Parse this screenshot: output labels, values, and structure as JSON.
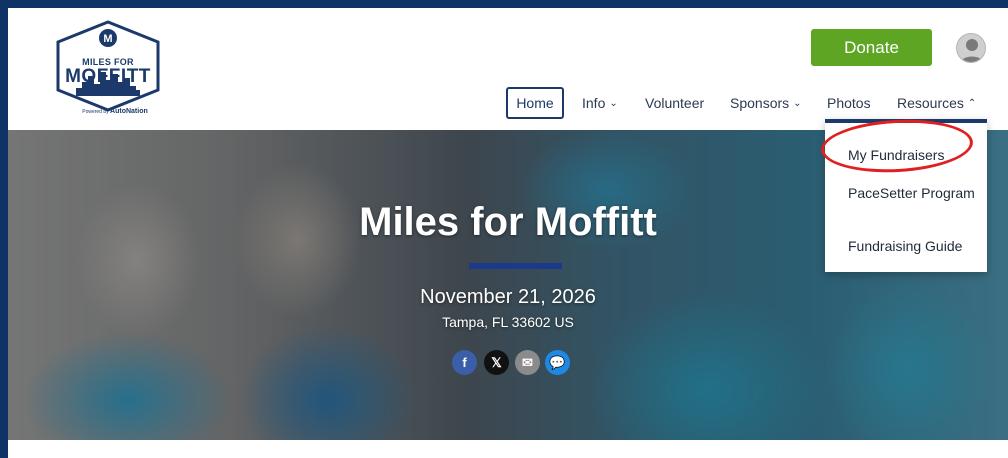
{
  "logo": {
    "top_text": "MILES FOR",
    "main_text": "MOFFITT",
    "powered_by": "Powered by",
    "sponsor": "AutoNation"
  },
  "header": {
    "donate_label": "Donate",
    "avatar_icon": "user-avatar-icon"
  },
  "nav": {
    "items": [
      {
        "label": "Home",
        "active": true
      },
      {
        "label": "Info",
        "has_dropdown": true
      },
      {
        "label": "Volunteer"
      },
      {
        "label": "Sponsors",
        "has_dropdown": true
      },
      {
        "label": "Photos"
      },
      {
        "label": "Resources",
        "has_dropdown": true,
        "open": true
      }
    ],
    "chevron_down": "⌄",
    "chevron_up": "⌃"
  },
  "resources_menu": {
    "items": [
      {
        "label": "My Fundraisers"
      },
      {
        "label": "PaceSetter Program"
      },
      {
        "label": "Fundraising Guide"
      }
    ]
  },
  "hero": {
    "title": "Miles for Moffitt",
    "date": "November 21, 2026",
    "location": "Tampa, FL 33602 US",
    "share_icons": [
      "facebook-icon",
      "x-icon",
      "email-icon",
      "comment-icon"
    ],
    "share_glyphs": {
      "facebook": "f",
      "x": "𝕏",
      "email": "✉",
      "comment": "💬"
    }
  },
  "colors": {
    "brand_navy": "#1b3a6b",
    "donate_green": "#5ea524",
    "page_border": "#0f3366",
    "highlight_red": "#e02020"
  }
}
